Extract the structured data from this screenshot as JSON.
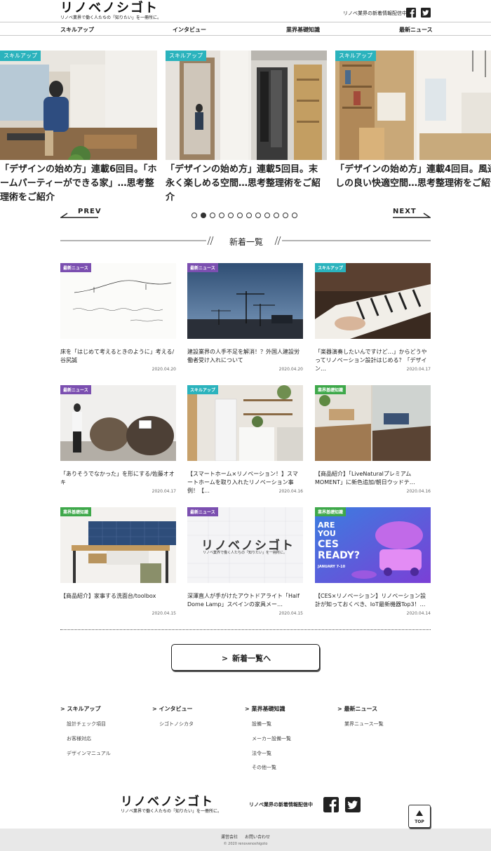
{
  "header": {
    "logo": "リノベノシゴト",
    "logo_sub": "リノベ業界で働く人たちの「知りたい」を一冊所に。",
    "tagline": "リノベ業界の新着情報配信中",
    "nav": [
      "スキルアップ",
      "インタビュー",
      "業界基礎知識",
      "最新ニュース"
    ]
  },
  "carousel": {
    "slides": [
      {
        "badge": "スキルアップ",
        "title": "「デザインの始め方」連載6回目。「ホームパーティーができる家」…思考整理術をご紹介"
      },
      {
        "badge": "スキルアップ",
        "title": "「デザインの始め方」連載5回目。末永く楽しめる空間…思考整理術をご紹介"
      },
      {
        "badge": "スキルアップ",
        "title": "「デザインの始め方」連載4回目。風通しの良い快適空間…思考整理術をご紹介"
      }
    ],
    "prev": "PREV",
    "next": "NEXT",
    "dot_count": 12,
    "active_dot": 2
  },
  "news": {
    "title": "新着一覧",
    "cards": [
      {
        "badge": "最新ニュース",
        "title": "床を「はじめて考えるときのように」考える/谷尻誠",
        "date": "2020.04.20"
      },
      {
        "badge": "最新ニュース",
        "title": "建設業界の人手不足を解消！？外国人建設労働者受け入れについて",
        "date": "2020.04.20"
      },
      {
        "badge": "スキルアップ",
        "title": "「楽器演奏したいんですけど…」からどうやってリノベーション設計はじめる？「デザイン…",
        "date": "2020.04.17"
      },
      {
        "badge": "最新ニュース",
        "title": "「ありそうでなかった」を形にする/佐藤オオキ",
        "date": "2020.04.17"
      },
      {
        "badge": "スキルアップ",
        "title": "【スマートホーム×リノベーション！】スマートホームを取り入れたリノベーション事例！【…",
        "date": "2020.04.16"
      },
      {
        "badge": "業界基礎知識",
        "title": "【商品紹介】「LiveNaturalプレミアム MOMENT」に新色追加/朝日ウッドテ…",
        "date": "2020.04.16"
      },
      {
        "badge": "業界基礎知識",
        "title": "【商品紹介】家事する洗面台/toolbox",
        "date": "2020.04.15"
      },
      {
        "badge": "最新ニュース",
        "title": "深澤直人が手がけたアウトドアライト「Half Dome Lamp」スペインの家具メー…",
        "date": "2020.04.15"
      },
      {
        "badge": "業界基礎知識",
        "title": "【CES×リノベーション】リノベーション設計が知っておくべき、IoT最新機器Top3！…",
        "date": "2020.04.14"
      }
    ],
    "more_label": "新着一覧へ",
    "ces_text": [
      "ARE",
      "YOU",
      "CES",
      "READY?",
      "JANUARY 7-10"
    ]
  },
  "footer": {
    "columns": [
      {
        "head": "スキルアップ",
        "links": [
          "設計チェック項目",
          "お客様対応",
          "デザインマニュアル"
        ]
      },
      {
        "head": "インタビュー",
        "links": [
          "シゴトノシカタ"
        ]
      },
      {
        "head": "業界基礎知識",
        "links": [
          "設備一覧",
          "メーカー設備一覧",
          "法令一覧",
          "その他一覧"
        ]
      },
      {
        "head": "最新ニュース",
        "links": [
          "業界ニュース一覧"
        ]
      }
    ],
    "logo": "リノベノシゴト",
    "logo_sub": "リノベ業界で働く人たちの「知りたい」を一冊所に。",
    "tagline": "リノベ業界の新着情報配信中",
    "bottom_links": [
      "運営会社",
      "お問い合わせ"
    ],
    "copyright": "© 2020 renovenoshigoto",
    "top_label": "TOP"
  },
  "colors": {
    "skillup": "#2bb3bd",
    "news": "#7b4fb0",
    "basics": "#3ea84a",
    "accent": "#222222"
  }
}
